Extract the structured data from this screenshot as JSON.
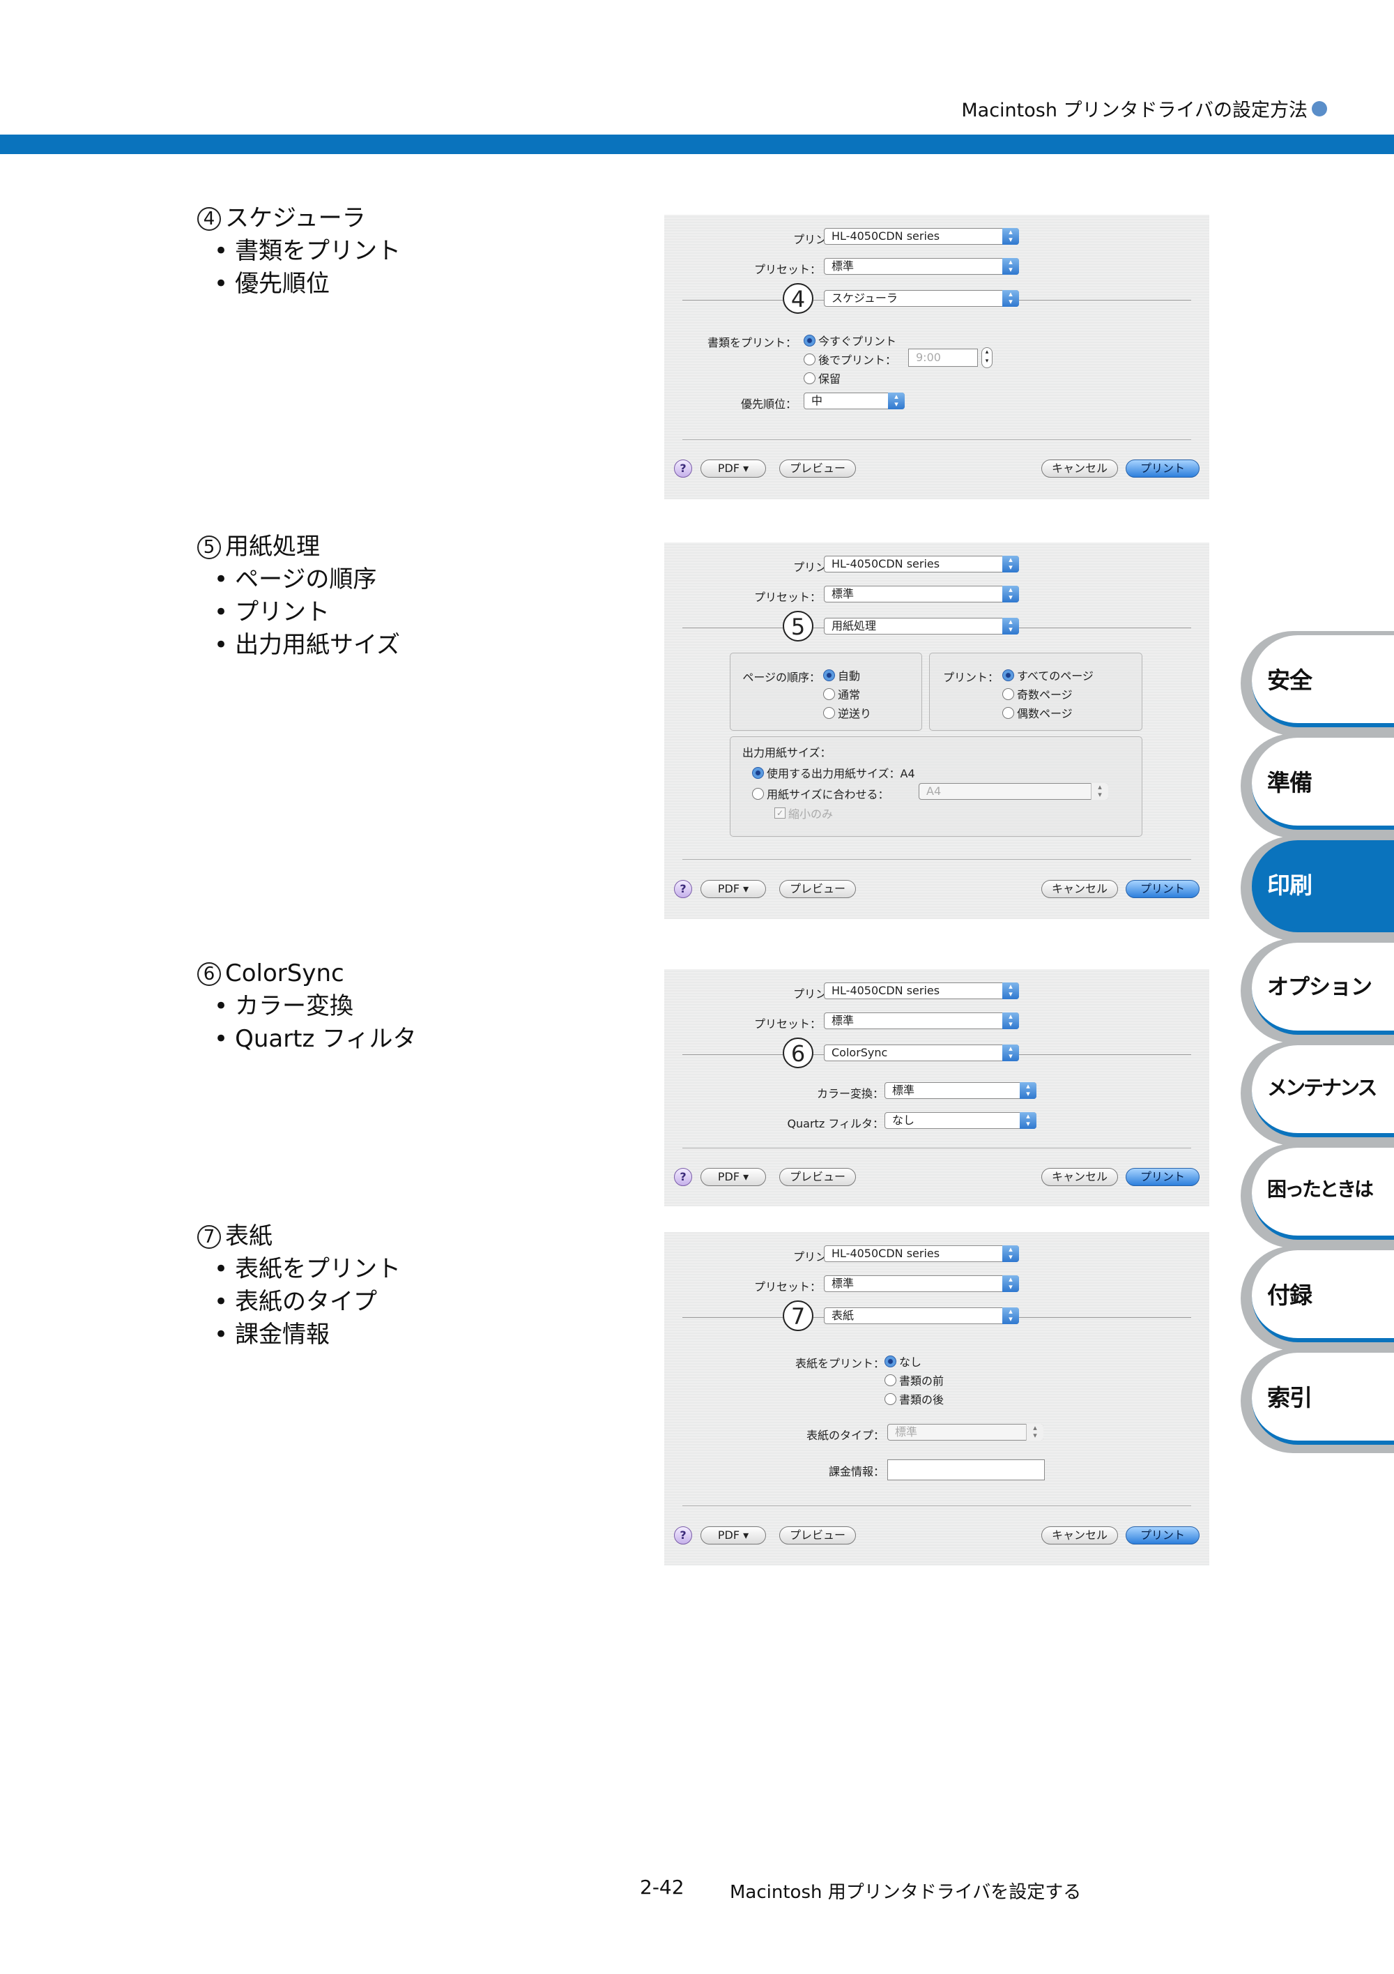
{
  "header": {
    "title": "Macintosh プリンタドライバの設定方法"
  },
  "sections": [
    {
      "num": "4",
      "title": "スケジューラ",
      "bullets": [
        "書類をプリント",
        "優先順位"
      ]
    },
    {
      "num": "5",
      "title": "用紙処理",
      "bullets": [
        "ページの順序",
        "プリント",
        "出力用紙サイズ"
      ]
    },
    {
      "num": "6",
      "title": "ColorSync",
      "bullets": [
        "カラー変換",
        "Quartz フィルタ"
      ]
    },
    {
      "num": "7",
      "title": "表紙",
      "bullets": [
        "表紙をプリント",
        "表紙のタイプ",
        "課金情報"
      ]
    }
  ],
  "dialog_common": {
    "printer_label": "プリンタ：",
    "printer_value": "HL-4050CDN series",
    "preset_label": "プリセット：",
    "preset_value": "標準",
    "help": "?",
    "pdf": "PDF ▾",
    "preview": "プレビュー",
    "cancel": "キャンセル",
    "print": "プリント"
  },
  "dialog4": {
    "panel": "スケジューラ",
    "print_doc_label": "書類をプリント：",
    "opt_now": "今すぐプリント",
    "opt_later": "後でプリント：",
    "later_time": "9:00",
    "opt_hold": "保留",
    "priority_label": "優先順位：",
    "priority_value": "中"
  },
  "dialog5": {
    "panel": "用紙処理",
    "order_label": "ページの順序：",
    "order_opts": [
      "自動",
      "通常",
      "逆送り"
    ],
    "print_label": "プリント：",
    "print_opts": [
      "すべてのページ",
      "奇数ページ",
      "偶数ページ"
    ],
    "paper_label": "出力用紙サイズ：",
    "use_paper": "使用する出力用紙サイズ：A4",
    "fit_paper": "用紙サイズに合わせる：",
    "fit_value": "A4",
    "shrink_only": "縮小のみ"
  },
  "dialog6": {
    "panel": "ColorSync",
    "conv_label": "カラー変換：",
    "conv_value": "標準",
    "quartz_label": "Quartz フィルタ：",
    "quartz_value": "なし"
  },
  "dialog7": {
    "panel": "表紙",
    "cover_label": "表紙をプリント：",
    "cover_opts": [
      "なし",
      "書類の前",
      "書類の後"
    ],
    "type_label": "表紙のタイプ：",
    "type_value": "標準",
    "billing_label": "課金情報："
  },
  "tabs": [
    "安全",
    "準備",
    "印刷",
    "オプション",
    "メンテナンス",
    "困ったときは",
    "付録",
    "索引"
  ],
  "footer": {
    "page": "2-42",
    "title": "Macintosh 用プリンタドライバを設定する"
  },
  "colors": {
    "accent": "#0a73bd",
    "tab_border": "#b5b8ba"
  }
}
